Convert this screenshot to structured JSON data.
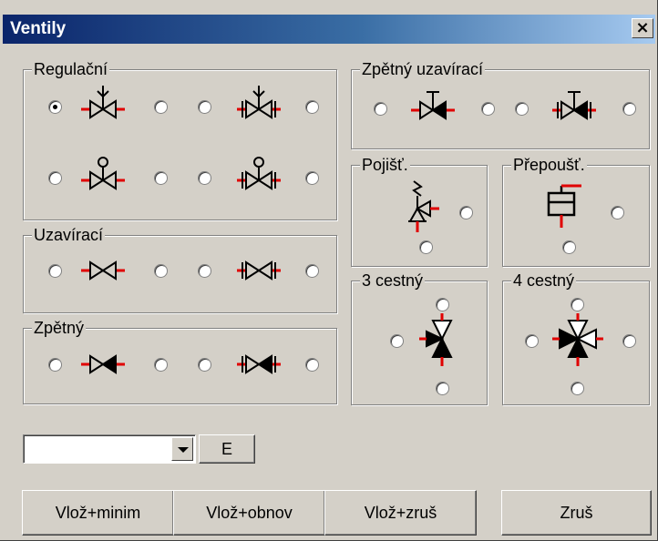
{
  "window": {
    "title": "Ventily",
    "close_glyph": "×"
  },
  "groups": {
    "regulacni": "Regulační",
    "uzaviraci": "Uzavírací",
    "zpetny": "Zpětný",
    "zpetny_uzaviraci": "Zpětný uzavírací",
    "pojist": "Pojišť.",
    "prepoust": "Přepoušť.",
    "trojcestny": "3 cestný",
    "ctyrcestny": "4 cestný"
  },
  "radios": {
    "selected": "regulacni-1-left"
  },
  "combo": {
    "value": ""
  },
  "buttons": {
    "e": "E",
    "vloz_minim": "Vlož+minim",
    "vloz_obnov": "Vlož+obnov",
    "vloz_zrus": "Vlož+zruš",
    "zrus": "Zruš"
  },
  "colors": {
    "accent_red": "#e00000",
    "title_from": "#0a246a",
    "title_to": "#a6caf0",
    "face": "#d4d0c8"
  },
  "icons": [
    "valve-arrow-icon",
    "valve-arrow-flanged-icon",
    "valve-motor-icon",
    "valve-motor-flanged-icon",
    "valve-icon",
    "valve-flanged-icon",
    "check-valve-icon",
    "check-valve-flanged-icon",
    "safety-valve-icon",
    "overflow-valve-icon",
    "three-way-valve-icon",
    "four-way-valve-icon"
  ]
}
